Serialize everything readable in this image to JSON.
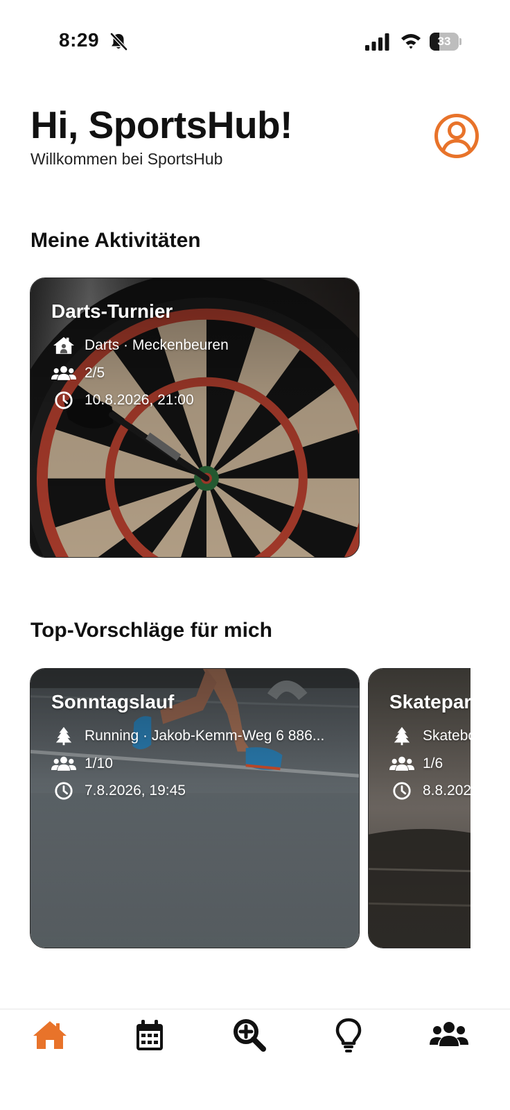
{
  "status_bar": {
    "time": "8:29",
    "battery_level": "33",
    "icons": [
      "bell-slash-icon",
      "signal-icon",
      "wifi-icon",
      "battery-icon"
    ]
  },
  "header": {
    "greeting": "Hi, SportsHub!",
    "subtitle": "Willkommen bei SportsHub",
    "profile_icon": "user-circle-icon"
  },
  "colors": {
    "accent": "#E8732A",
    "text": "#111111"
  },
  "my_activities": {
    "title": "Meine Aktivitäten",
    "cards": [
      {
        "title": "Darts-Turnier",
        "location": "Darts · Meckenbeuren",
        "location_icon": "house-icon",
        "participants": "2/5",
        "datetime": "10.8.2026, 21:00",
        "image": "darts-board-photo"
      }
    ]
  },
  "suggestions": {
    "title": "Top-Vorschläge für mich",
    "cards": [
      {
        "title": "Sonntagslauf",
        "location": "Running · Jakob-Kemm-Weg 6 886...",
        "location_icon": "tree-icon",
        "participants": "1/10",
        "datetime": "7.8.2026, 19:45",
        "image": "runner-photo"
      },
      {
        "title": "Skatepar",
        "location": "Skatebo",
        "location_icon": "tree-icon",
        "participants": "1/6",
        "datetime": "8.8.202",
        "image": "skatepark-photo"
      }
    ]
  },
  "tab_bar": {
    "items": [
      {
        "name": "home",
        "icon": "home-icon",
        "active": true
      },
      {
        "name": "calendar",
        "icon": "calendar-icon",
        "active": false
      },
      {
        "name": "search",
        "icon": "search-plus-icon",
        "active": false
      },
      {
        "name": "ideas",
        "icon": "lightbulb-icon",
        "active": false
      },
      {
        "name": "groups",
        "icon": "users-icon",
        "active": false
      }
    ]
  }
}
